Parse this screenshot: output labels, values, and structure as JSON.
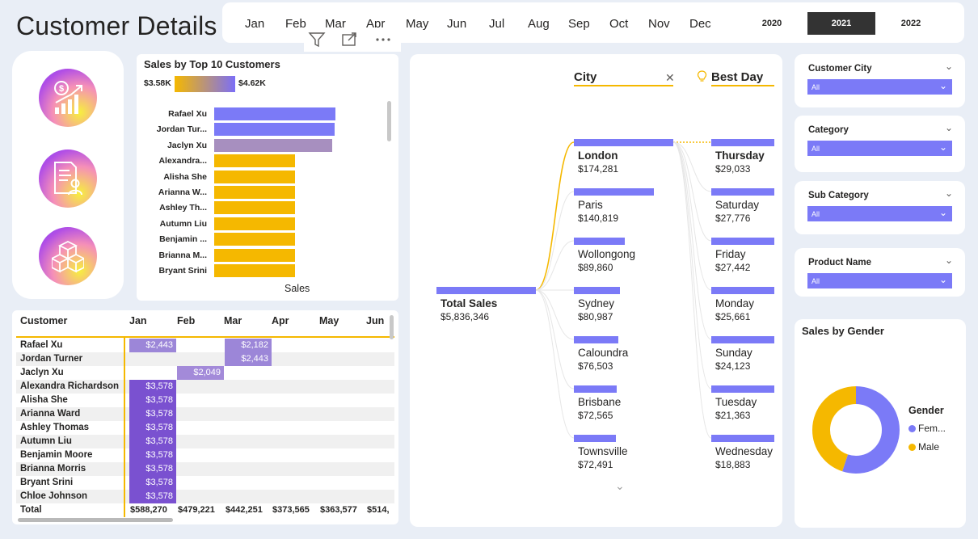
{
  "header": {
    "title": "Customer Details",
    "months": [
      "Jan",
      "Feb",
      "Mar",
      "Apr",
      "May",
      "Jun",
      "Jul",
      "Aug",
      "Sep",
      "Oct",
      "Nov",
      "Dec"
    ],
    "years": [
      "2020",
      "2021",
      "2022"
    ],
    "selected_year": "2021"
  },
  "visual_header": {
    "icons": [
      "filter-icon",
      "focus-mode-icon",
      "more-options-icon"
    ]
  },
  "top10": {
    "title": "Sales by Top 10 Customers",
    "scale_min": "$3.58K",
    "scale_max": "$4.62K",
    "xlabel": "Sales",
    "colors": {
      "high": "#7b7af7",
      "mid": "#a78fbf",
      "low": "#f5b800"
    },
    "customers": [
      "Rafael Xu",
      "Jordan Tur...",
      "Jaclyn Xu",
      "Alexandra...",
      "Alisha She",
      "Arianna W...",
      "Ashley Th...",
      "Autumn Liu",
      "Benjamin ...",
      "Brianna M...",
      "Bryant Srini"
    ]
  },
  "chart_data": {
    "type": "bar",
    "categories": [
      "Rafael Xu",
      "Jordan Tur...",
      "Jaclyn Xu",
      "Alexandra...",
      "Alisha She",
      "Arianna W...",
      "Ashley Th...",
      "Autumn Liu",
      "Benjamin ...",
      "Brianna M...",
      "Bryant Srini"
    ],
    "values": [
      4625,
      4600,
      4520,
      3578,
      3578,
      3578,
      3578,
      3578,
      3578,
      3578,
      3578
    ],
    "xlabel": "Sales",
    "title": "Sales by Top 10 Customers"
  },
  "matrix": {
    "headers": [
      "Customer",
      "Jan",
      "Feb",
      "Mar",
      "Apr",
      "May",
      "Jun"
    ],
    "rows": [
      {
        "name": "Rafael Xu",
        "jan": "$2,443",
        "feb": "",
        "mar": "$2,182"
      },
      {
        "name": "Jordan Turner",
        "jan": "",
        "feb": "",
        "mar": "$2,443"
      },
      {
        "name": "Jaclyn Xu",
        "jan": "",
        "feb": "$2,049",
        "mar": ""
      },
      {
        "name": "Alexandra Richardson",
        "jan": "$3,578",
        "feb": "",
        "mar": ""
      },
      {
        "name": "Alisha She",
        "jan": "$3,578",
        "feb": "",
        "mar": ""
      },
      {
        "name": "Arianna Ward",
        "jan": "$3,578",
        "feb": "",
        "mar": ""
      },
      {
        "name": "Ashley Thomas",
        "jan": "$3,578",
        "feb": "",
        "mar": ""
      },
      {
        "name": "Autumn Liu",
        "jan": "$3,578",
        "feb": "",
        "mar": ""
      },
      {
        "name": "Benjamin Moore",
        "jan": "$3,578",
        "feb": "",
        "mar": ""
      },
      {
        "name": "Brianna Morris",
        "jan": "$3,578",
        "feb": "",
        "mar": ""
      },
      {
        "name": "Bryant Srini",
        "jan": "$3,578",
        "feb": "",
        "mar": ""
      },
      {
        "name": "Chloe Johnson",
        "jan": "$3,578",
        "feb": "",
        "mar": ""
      }
    ],
    "total_label": "Total",
    "totals": [
      "$588,270",
      "$479,221",
      "$442,251",
      "$373,565",
      "$363,577",
      "$514,"
    ]
  },
  "tree": {
    "city_header": "City",
    "bestday_header": "Best Day",
    "root": {
      "name": "Total Sales",
      "value": "$5,836,346"
    },
    "cities": [
      {
        "name": "London",
        "value": "$174,281"
      },
      {
        "name": "Paris",
        "value": "$140,819"
      },
      {
        "name": "Wollongong",
        "value": "$89,860"
      },
      {
        "name": "Sydney",
        "value": "$80,987"
      },
      {
        "name": "Caloundra",
        "value": "$76,503"
      },
      {
        "name": "Brisbane",
        "value": "$72,565"
      },
      {
        "name": "Townsville",
        "value": "$72,491"
      }
    ],
    "days": [
      {
        "name": "Thursday",
        "value": "$29,033"
      },
      {
        "name": "Saturday",
        "value": "$27,776"
      },
      {
        "name": "Friday",
        "value": "$27,442"
      },
      {
        "name": "Monday",
        "value": "$25,661"
      },
      {
        "name": "Sunday",
        "value": "$24,123"
      },
      {
        "name": "Tuesday",
        "value": "$21,363"
      },
      {
        "name": "Wednesday",
        "value": "$18,883"
      }
    ]
  },
  "slicers": [
    {
      "title": "Customer City",
      "value": "All"
    },
    {
      "title": "Category",
      "value": "All"
    },
    {
      "title": "Sub Category",
      "value": "All"
    },
    {
      "title": "Product Name",
      "value": "All"
    }
  ],
  "gender": {
    "title": "Sales by Gender",
    "legend_title": "Gender",
    "items": [
      {
        "label": "Fem...",
        "color": "#7b7af7",
        "share": 0.55
      },
      {
        "label": "Male",
        "color": "#f5b800",
        "share": 0.45
      }
    ]
  }
}
